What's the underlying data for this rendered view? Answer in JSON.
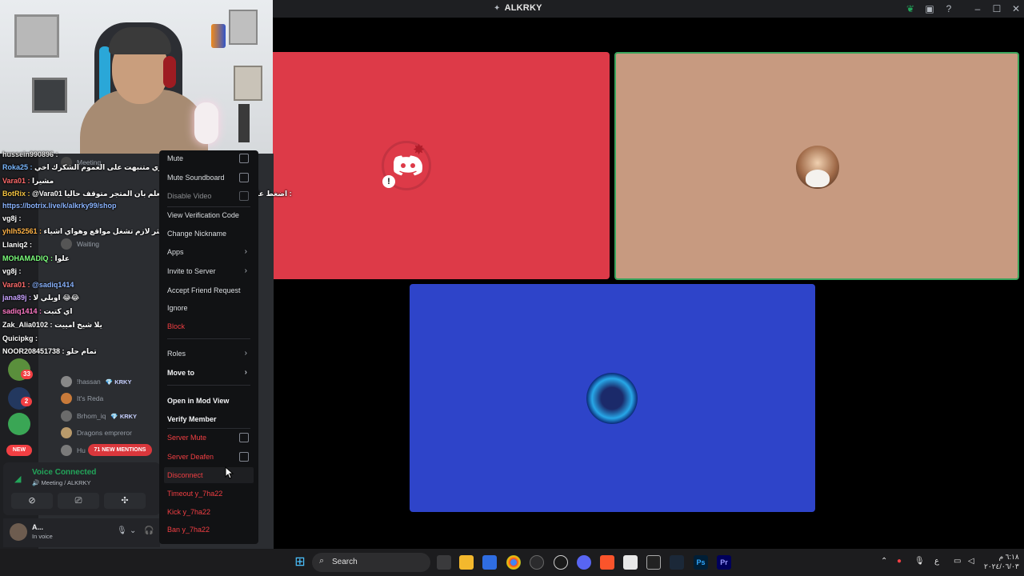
{
  "window": {
    "title": "ALKRKY"
  },
  "chat_overlay": [
    {
      "user": "hussein990896 :",
      "text": "",
      "color": "#e6e6e6"
    },
    {
      "user": "Roka25 :",
      "text": "سوري متنبهت على العموم الشكرك اخي ✨",
      "color": "#7ab8ff"
    },
    {
      "user": "Vara01 :",
      "text": "مشيرا",
      "color": "#ff6b6b"
    },
    {
      "user": "BotRix :",
      "text": "@Vara01 اضغط على الرابط لرؤية المتجر مع العلم بان المتجر متوقف حاليا :",
      "color": "#f5c542"
    },
    {
      "user": "",
      "text": "https://botrix.live/k/alkrky99/shop",
      "color": "#8ab4ff"
    },
    {
      "user": "vg8j :",
      "text": "",
      "color": "#e6e6e6"
    },
    {
      "user": "yhlh52561 :",
      "text": "ما اكثر لازم تشغل مواقع وهواي اشياء",
      "color": "#ffb347"
    },
    {
      "user": "Llaniq2 :",
      "text": "",
      "color": "#e6e6e6"
    },
    {
      "user": "MOHAMADIQ :",
      "text": "علوا",
      "color": "#7cff7c"
    },
    {
      "user": "vg8j :",
      "text": "",
      "color": "#e6e6e6"
    },
    {
      "user": "Vara01 :",
      "text": "@sadiq1414",
      "color": "#ff6b6b"
    },
    {
      "user": "jana89j :",
      "text": "اوبلي لا 😂😂",
      "color": "#c8a2ff"
    },
    {
      "user": "sadiq1414 :",
      "text": "اي كتبت",
      "color": "#ff79c6"
    },
    {
      "user": "Zak_Alia0102 :",
      "text": "يلا شيخ امييت",
      "color": "#e6e6e6"
    },
    {
      "user": "Quicipkg :",
      "text": "",
      "color": "#e6e6e6"
    },
    {
      "user": "NOOR208451738 :",
      "text": "تمام حلو",
      "color": "#e6e6e6"
    }
  ],
  "members": [
    {
      "name": "Meeting",
      "tag": ""
    },
    {
      "name": "Waiting",
      "tag": ""
    },
    {
      "name": "!hassan",
      "tag": "💎 KRKY"
    },
    {
      "name": "It's Reda",
      "tag": ""
    },
    {
      "name": "Brhom_iq",
      "tag": "💎 KRKY"
    },
    {
      "name": "Dragons empreror",
      "tag": ""
    },
    {
      "name": "Hu",
      "tag": ""
    }
  ],
  "server_badges": [
    "33",
    "2"
  ],
  "new_pill": "NEW",
  "mentions_pill": "71 NEW MENTIONS",
  "voice": {
    "status": "Voice Connected",
    "location": "Meeting / ALKRKY"
  },
  "user": {
    "name": "A...",
    "sub": "In voice"
  },
  "context_menu": [
    {
      "label": "Mute",
      "style": "normal",
      "type": "check"
    },
    {
      "label": "Mute Soundboard",
      "style": "normal",
      "type": "check"
    },
    {
      "label": "Disable Video",
      "style": "normal",
      "type": "check"
    },
    {
      "label": "View Verification Code",
      "style": "normal",
      "type": "item"
    },
    {
      "label": "Change Nickname",
      "style": "normal",
      "type": "item"
    },
    {
      "label": "Apps",
      "style": "normal",
      "type": "submenu"
    },
    {
      "label": "Invite to Server",
      "style": "normal",
      "type": "submenu"
    },
    {
      "label": "Accept Friend Request",
      "style": "normal",
      "type": "item"
    },
    {
      "label": "Ignore",
      "style": "normal",
      "type": "item"
    },
    {
      "label": "Block",
      "style": "danger",
      "type": "item"
    },
    {
      "label": "Roles",
      "style": "normal",
      "type": "submenu"
    },
    {
      "label": "Move to",
      "style": "bold",
      "type": "submenu"
    },
    {
      "label": "Open in Mod View",
      "style": "bold",
      "type": "item"
    },
    {
      "label": "Verify Member",
      "style": "bold",
      "type": "item"
    },
    {
      "label": "Server Mute",
      "style": "danger",
      "type": "check"
    },
    {
      "label": "Server Deafen",
      "style": "danger",
      "type": "check"
    },
    {
      "label": "Disconnect",
      "style": "danger",
      "type": "item"
    },
    {
      "label": "Timeout y_7ha22",
      "style": "danger",
      "type": "item"
    },
    {
      "label": "Kick y_7ha22",
      "style": "danger",
      "type": "item"
    },
    {
      "label": "Ban y_7ha22",
      "style": "danger",
      "type": "item"
    }
  ],
  "taskbar": {
    "search_label": "Search",
    "clock_time": "٦:١٨ م",
    "clock_date": "٢٠٢٤/٠٦/٠٣",
    "lang": "ع"
  },
  "colors": {
    "tile_red": "#dd3a48",
    "tile_tan": "#c79a80",
    "tile_blue": "#2e44c9",
    "speaking_border": "#3ba55d",
    "danger": "#f23f43"
  }
}
